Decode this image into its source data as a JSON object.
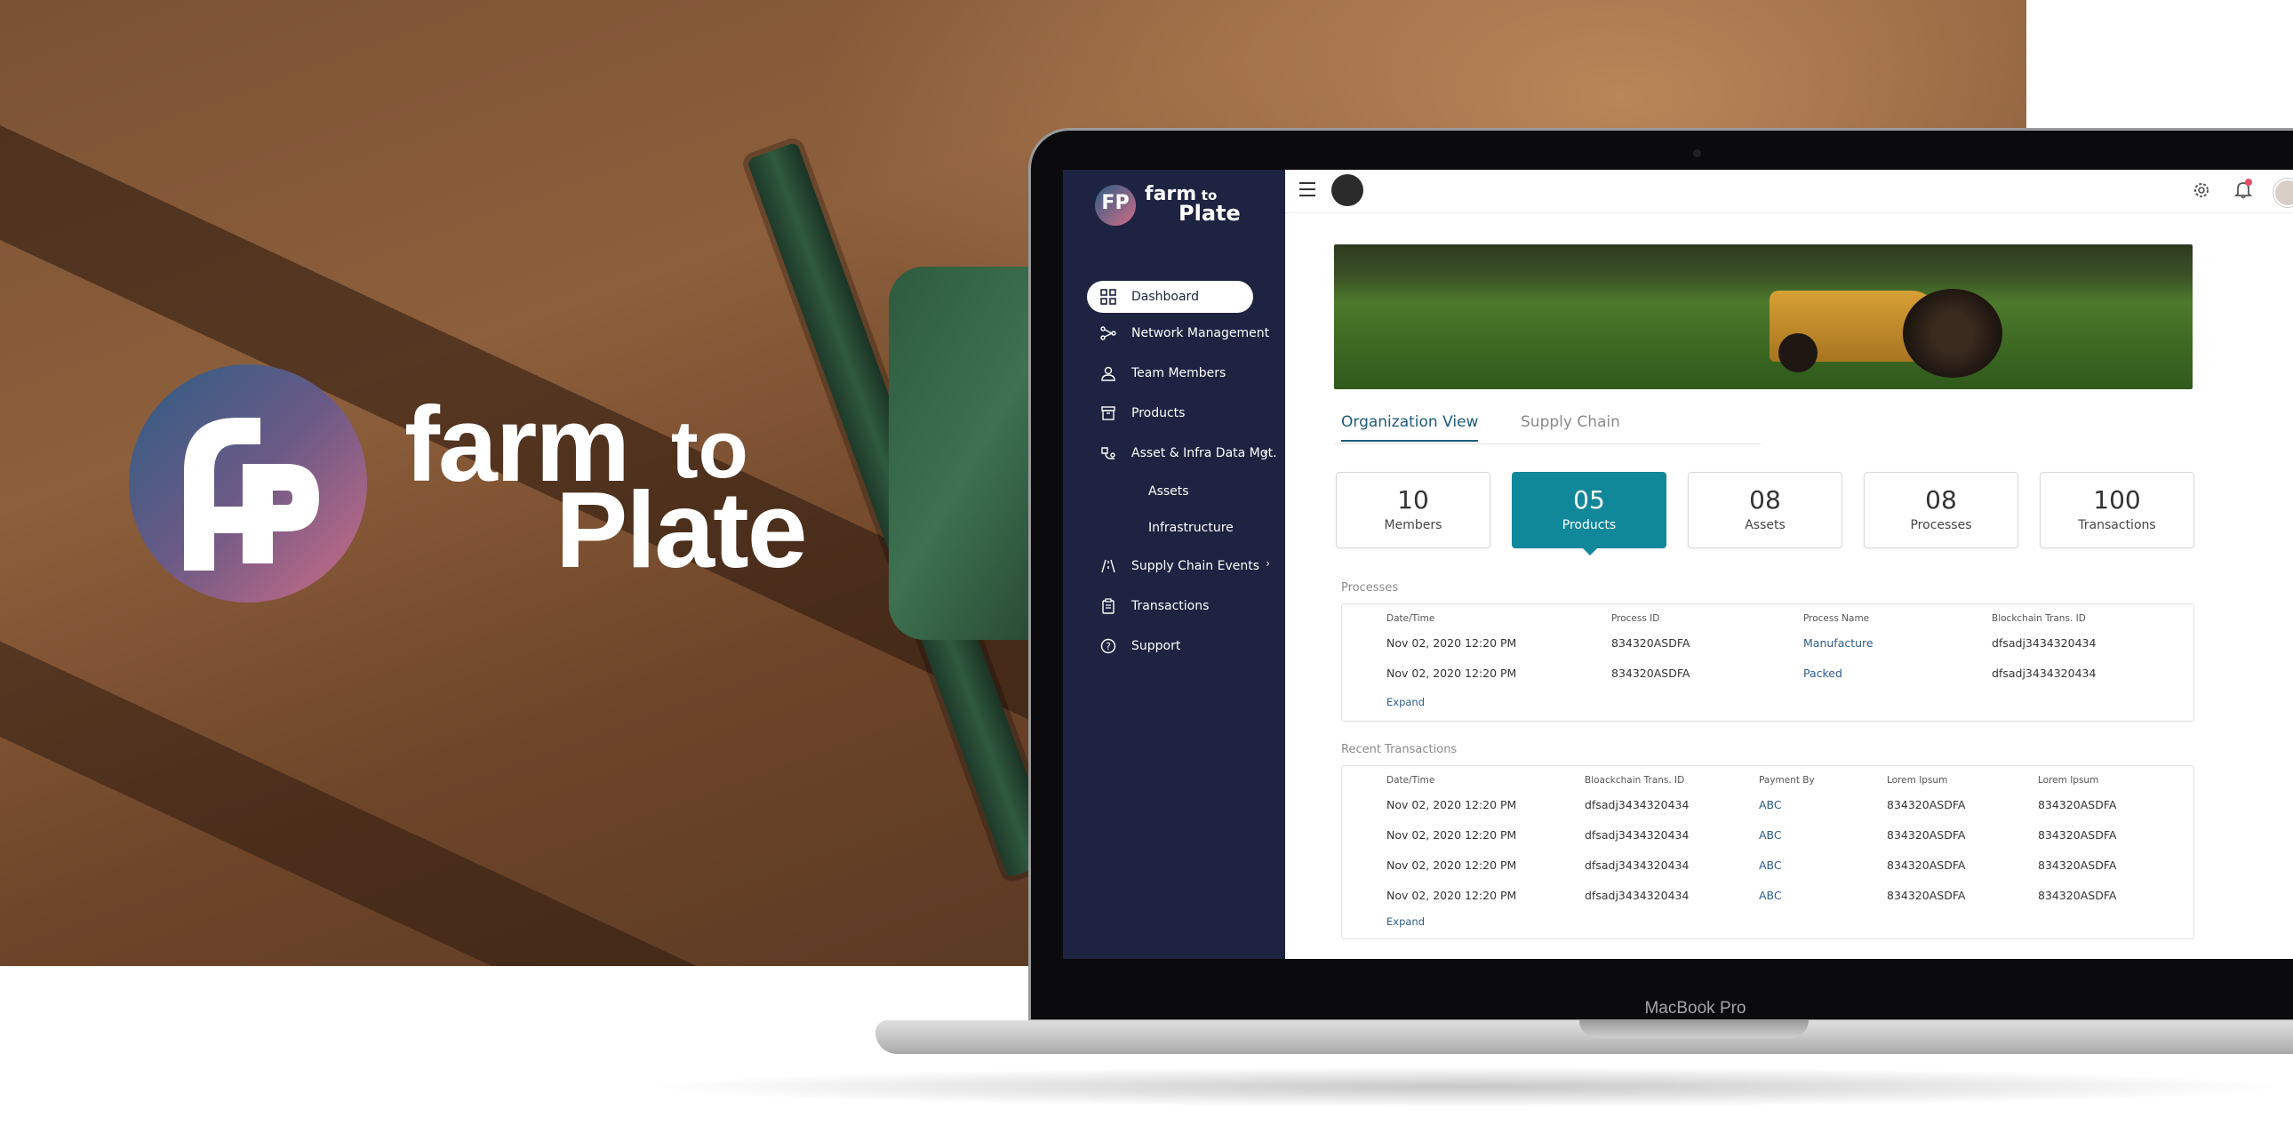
{
  "brand": {
    "hero_word_1": "farm",
    "hero_word_2": "to",
    "hero_word_3": "Plate",
    "logo_letters": "FP",
    "laptop_label": "MacBook Pro",
    "colors": {
      "sidebar": "#1d2340",
      "accent": "#11879a",
      "link": "#2d5c8c",
      "tab_active": "#1e5a7a"
    }
  },
  "sidebar": {
    "items": [
      {
        "label": "Dashboard",
        "icon": "grid-icon",
        "active": true
      },
      {
        "label": "Network Management",
        "icon": "network-icon"
      },
      {
        "label": "Team Members",
        "icon": "team-icon"
      },
      {
        "label": "Products",
        "icon": "box-icon"
      },
      {
        "label": "Asset & Infra Data Mgt.",
        "icon": "asset-icon",
        "expanded": true
      },
      {
        "label": "Supply Chain Events",
        "icon": "road-icon"
      },
      {
        "label": "Transactions",
        "icon": "clipboard-icon"
      },
      {
        "label": "Support",
        "icon": "help-icon"
      }
    ],
    "sub_items": [
      "Assets",
      "Infrastructure"
    ]
  },
  "tabs": [
    "Organization View",
    "Supply Chain"
  ],
  "stats": [
    {
      "value": "10",
      "label": "Members"
    },
    {
      "value": "05",
      "label": "Products",
      "selected": true
    },
    {
      "value": "08",
      "label": "Assets"
    },
    {
      "value": "08",
      "label": "Processes"
    },
    {
      "value": "100",
      "label": "Transactions"
    }
  ],
  "processes": {
    "title": "Processes",
    "headers": [
      "Date/Time",
      "Process ID",
      "Process Name",
      "Blockchain Trans. ID"
    ],
    "rows": [
      [
        "Nov 02, 2020 12:20 PM",
        "834320ASDFA",
        "Manufacture",
        "dfsadj3434320434"
      ],
      [
        "Nov 02, 2020 12:20 PM",
        "834320ASDFA",
        "Packed",
        "dfsadj3434320434"
      ]
    ],
    "expand": "Expand"
  },
  "transactions": {
    "title": "Recent Transactions",
    "headers": [
      "Date/Time",
      "Bloackchain Trans. ID",
      "Payment By",
      "Lorem Ipsum",
      "Lorem Ipsum"
    ],
    "rows": [
      [
        "Nov 02, 2020 12:20 PM",
        "dfsadj3434320434",
        "ABC",
        "834320ASDFA",
        "834320ASDFA"
      ],
      [
        "Nov 02, 2020 12:20 PM",
        "dfsadj3434320434",
        "ABC",
        "834320ASDFA",
        "834320ASDFA"
      ],
      [
        "Nov 02, 2020 12:20 PM",
        "dfsadj3434320434",
        "ABC",
        "834320ASDFA",
        "834320ASDFA"
      ],
      [
        "Nov 02, 2020 12:20 PM",
        "dfsadj3434320434",
        "ABC",
        "834320ASDFA",
        "834320ASDFA"
      ]
    ],
    "expand": "Expand"
  }
}
